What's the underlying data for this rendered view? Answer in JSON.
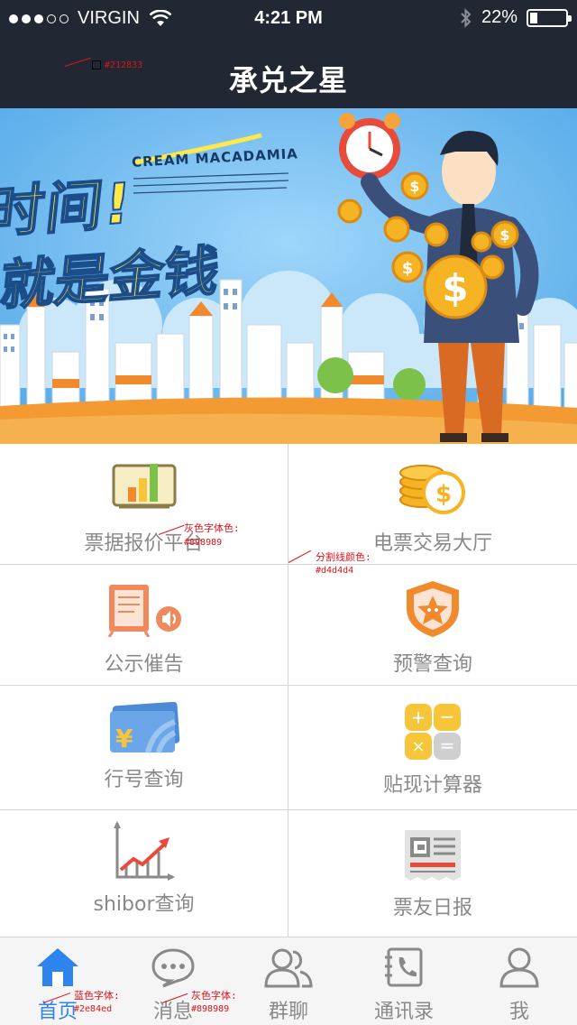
{
  "status_bar": {
    "carrier": "VIRGIN",
    "time": "4:21 PM",
    "battery": "22%",
    "battery_level": 0.22
  },
  "header": {
    "title": "承兑之星"
  },
  "annotations": {
    "header_color": "#212833",
    "gray_font_label": "灰色字体色:",
    "gray_font_value": "#898989",
    "divider_label": "分割线颜色:",
    "divider_value": "#d4d4d4",
    "blue_tab_label": "蓝色字体:",
    "blue_tab_value": "#2e84ed",
    "gray_tab_label": "灰色字体:",
    "gray_tab_value": "#898989"
  },
  "banner": {
    "brand": "CREAM MACADAMIA",
    "headline_1": "时间!",
    "headline_2": "就是金钱"
  },
  "grid": {
    "items": [
      {
        "label": "票据报价平台",
        "icon": "bar-chart-icon"
      },
      {
        "label": "电票交易大厅",
        "icon": "coins-icon"
      },
      {
        "label": "公示催告",
        "icon": "notice-board-icon"
      },
      {
        "label": "预警查询",
        "icon": "warning-shield-icon"
      },
      {
        "label": "行号查询",
        "icon": "bank-card-icon"
      },
      {
        "label": "贴现计算器",
        "icon": "calculator-icon"
      },
      {
        "label": "shibor查询",
        "icon": "trend-chart-icon"
      },
      {
        "label": "票友日报",
        "icon": "newspaper-icon"
      }
    ]
  },
  "tabbar": {
    "items": [
      {
        "label": "首页",
        "icon": "home-icon",
        "active": true
      },
      {
        "label": "消息",
        "icon": "chat-bubble-icon",
        "active": false
      },
      {
        "label": "群聊",
        "icon": "group-icon",
        "active": false
      },
      {
        "label": "通讯录",
        "icon": "contacts-icon",
        "active": false
      },
      {
        "label": "我",
        "icon": "user-icon",
        "active": false
      }
    ]
  },
  "colors": {
    "header_bg": "#212833",
    "gray_text": "#898989",
    "divider": "#d4d4d4",
    "active_blue": "#2e84ed"
  }
}
